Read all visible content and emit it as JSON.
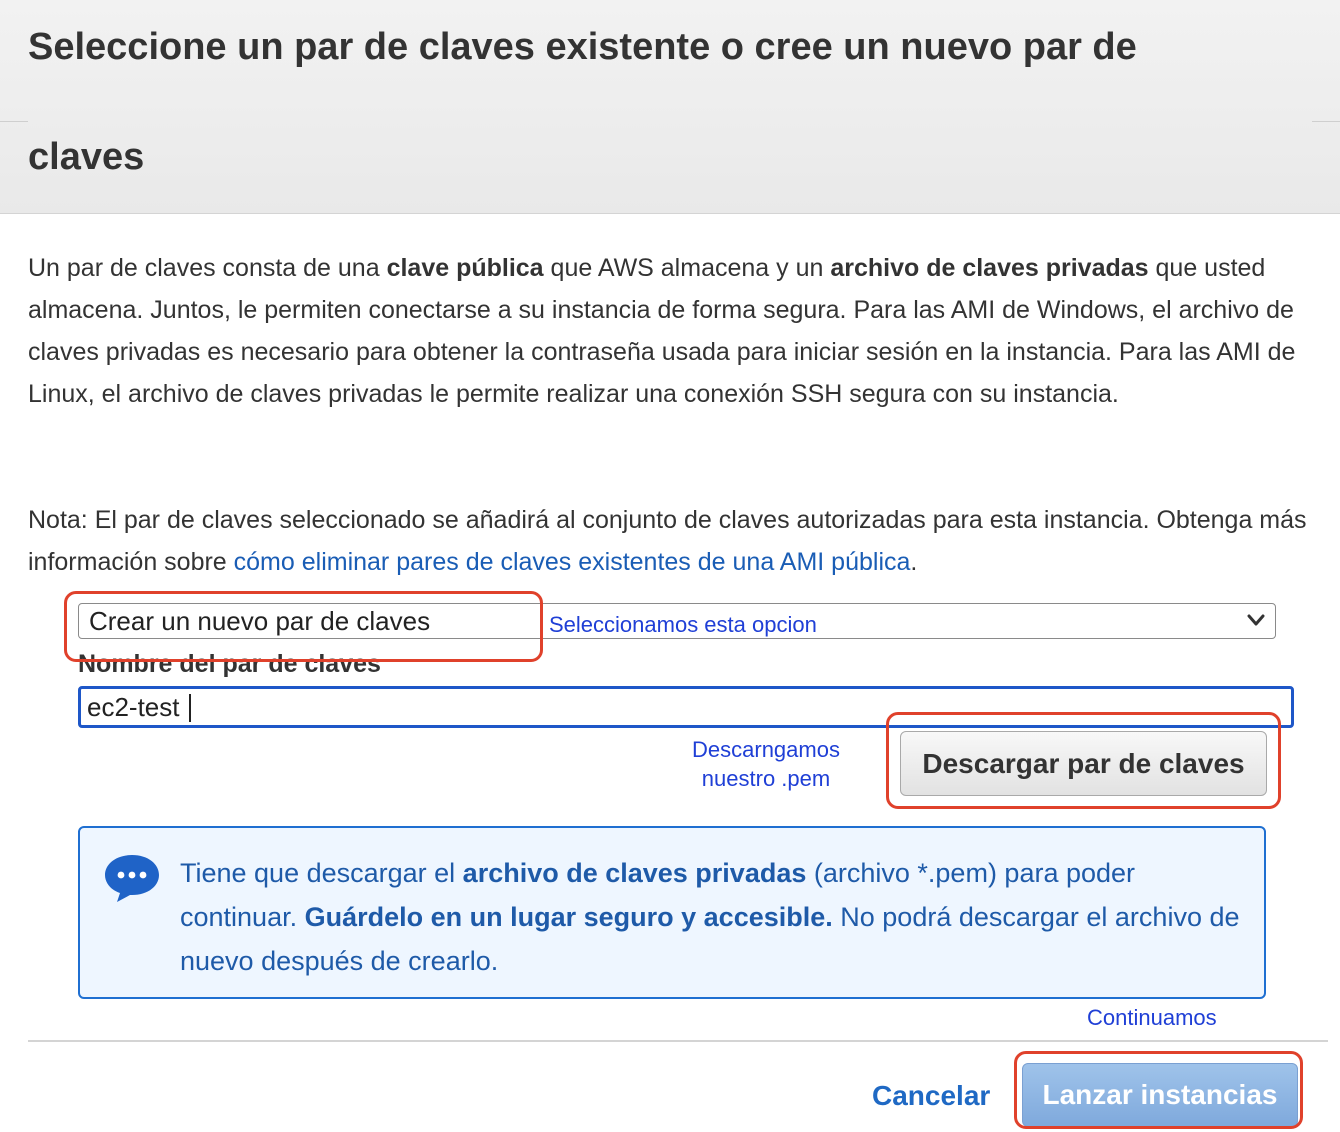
{
  "header": {
    "title_line1": "Seleccione un par de claves existente o cree un nuevo par de",
    "title_line2": "claves"
  },
  "description": {
    "t1": "Un par de claves consta de una ",
    "b1": "clave pública",
    "t2": " que AWS almacena y un ",
    "b2": "archivo de claves privadas",
    "t3": " que usted almacena. Juntos, le permiten conectarse a su instancia de forma segura. Para las AMI de Windows, el archivo de claves privadas es necesario para obtener la contraseña usada para iniciar sesión en la instancia. Para las AMI de Linux, el archivo de claves privadas le permite realizar una conexión SSH segura con su instancia."
  },
  "note": {
    "text": "Nota: El par de claves seleccionado se añadirá al conjunto de claves autorizadas para esta instancia. Obtenga más información sobre ",
    "link": "cómo eliminar pares de claves existentes de una AMI pública",
    "after": "."
  },
  "keypair_select": {
    "value": "Crear un nuevo par de claves"
  },
  "keypair_name": {
    "label": "Nombre del par de claves",
    "value": "ec2-test"
  },
  "download_button": {
    "label": "Descargar par de claves"
  },
  "annotations": {
    "select_note": "Seleccionamos esta opcion",
    "download_note_line1": "Descarngamos",
    "download_note_line2": "nuestro .pem",
    "continue_note": "Continuamos"
  },
  "info_box": {
    "t1": "Tiene que descargar el ",
    "b1": "archivo de claves privadas",
    "t2": " (archivo *.pem) para poder continuar. ",
    "b2": "Guárdelo en un lugar seguro y accesible.",
    "t3": " No podrá descargar el archivo de nuevo después de crearlo."
  },
  "footer": {
    "cancel_label": "Cancelar",
    "launch_label": "Lanzar instancias"
  },
  "colors": {
    "link": "#1a5db5",
    "annotation": "#1f3fd6",
    "highlight": "#e0412b",
    "info_border": "#1f6fd1"
  }
}
